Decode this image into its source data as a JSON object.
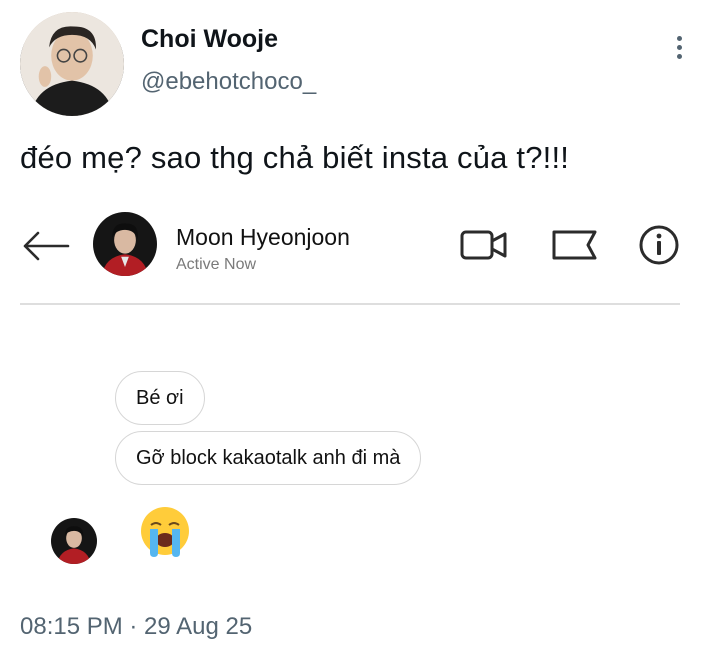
{
  "tweet": {
    "author_name": "Choi Wooje",
    "author_handle": "@ebehotchoco_",
    "text": "đéo mẹ? sao thg chả biết insta của t?!!!",
    "timestamp": "08:15 PM · 29 Aug 25"
  },
  "dm": {
    "contact_name": "Moon Hyeonjoon",
    "contact_status": "Active Now",
    "messages": [
      {
        "text": "Bé ơi"
      },
      {
        "text": "Gỡ block kakaotalk anh đi mà"
      }
    ],
    "emoji_icon": "crying-face-emoji"
  },
  "colors": {
    "text_primary": "#0f1419",
    "text_secondary": "#536471",
    "bubble_border": "#d6d6d6",
    "divider": "#dedede"
  }
}
